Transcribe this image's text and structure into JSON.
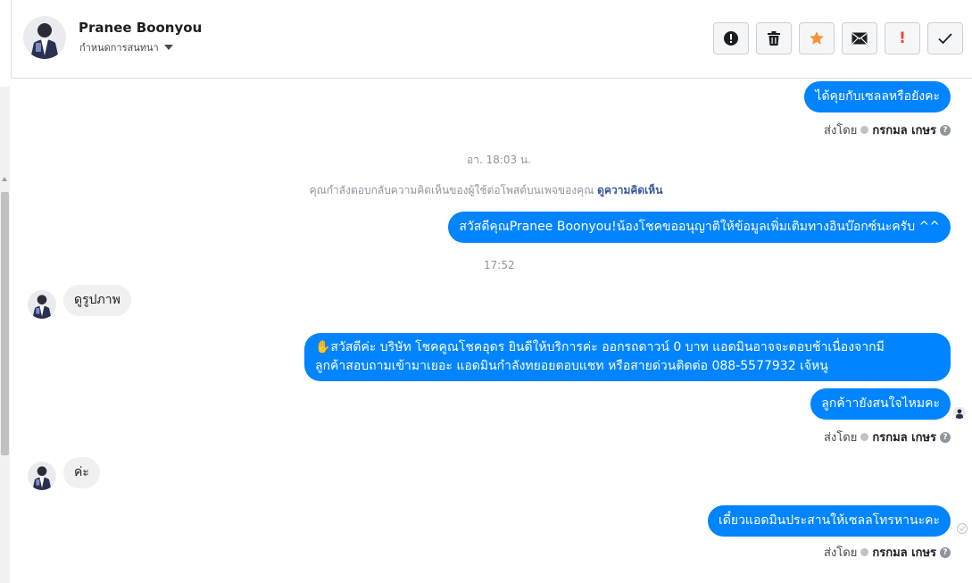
{
  "header": {
    "contact_name": "Pranee Boonyou",
    "assign_label": "กำหนดการสนทนา"
  },
  "toolbar": {
    "icons": [
      "spam-alert-icon",
      "trash-icon",
      "star-icon",
      "envelope-icon",
      "follow-up-icon",
      "check-icon"
    ],
    "follow_up_glyph": "!"
  },
  "colors": {
    "outgoing": "#0084ff",
    "incoming": "#f1f0f0",
    "star": "#f7923b",
    "alert": "#fa3e3e"
  },
  "messages": {
    "m1": "ได้คุยกับเซลลหรือยังคะ",
    "time1": "อา. 18:03 น.",
    "notice_text": "คุณกำลังตอบกลับความคิดเห็นของผู้ใช้ต่อโพสต์บนเพจของคุณ",
    "notice_link": "ดูความคิดเห็น",
    "m2": "สวัสดีคุณPranee Boonyou!น้องโชคขออนุญาติให้ข้อมูลเพิ่มเติมทางอินบ๊อกซ์นะครับ ^^",
    "time2": "17:52",
    "in1": "ดูรูปภาพ",
    "m3_line1": "✋สวัสดีค่ะ บริษัท โชคคูณโชคอุดร ยินดีให้บริการค่ะ ออกรถดาวน์ 0 บาท แอดมินอาจจะตอบช้าเนื่องจากมี",
    "m3_line2": "ลูกค้าสอบถามเข้ามาเยอะ แอดมินกำลังทยอยตอบแชท หรือสายด่วนติดต่อ 088-5577932 เจ้หนู",
    "m4": "ลูกค้าายังสนใจไหมคะ",
    "in2": "ค่ะ",
    "m5": "เดี๋ยวแอดมินประสานให้เซลลโทรหานะคะ"
  },
  "sent_by": {
    "label": "ส่งโดย",
    "name": "กรกมล เกษร",
    "help": "?"
  }
}
